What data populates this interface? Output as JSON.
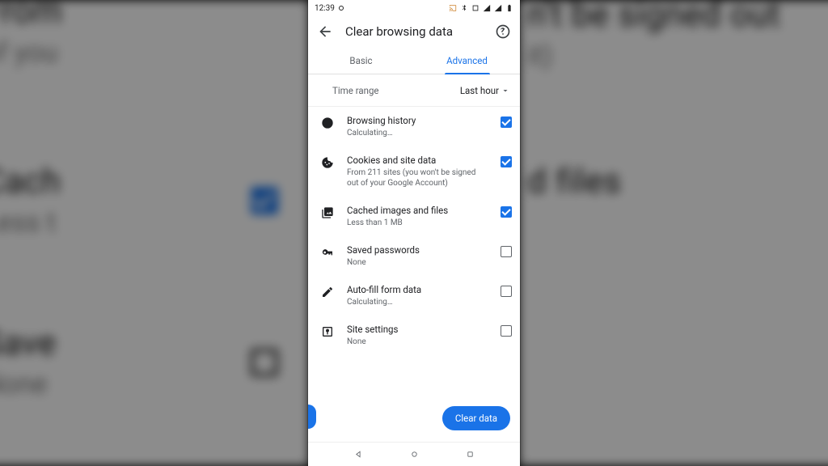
{
  "status": {
    "time": "12:39"
  },
  "header": {
    "title": "Clear browsing data"
  },
  "tabs": {
    "basic": "Basic",
    "advanced": "Advanced",
    "active": "advanced"
  },
  "timerange": {
    "label": "Time range",
    "value": "Last hour"
  },
  "rows": {
    "history": {
      "title": "Browsing history",
      "sub": "Calculating…",
      "checked": true
    },
    "cookies": {
      "title": "Cookies and site data",
      "sub": "From 211 sites (you won't be signed out of your Google Account)",
      "checked": true
    },
    "cache": {
      "title": "Cached images and files",
      "sub": "Less than 1 MB",
      "checked": true
    },
    "passwords": {
      "title": "Saved passwords",
      "sub": "None",
      "checked": false
    },
    "autofill": {
      "title": "Auto-fill form data",
      "sub": "Calculating…",
      "checked": false
    },
    "site": {
      "title": "Site settings",
      "sub": "None",
      "checked": false
    }
  },
  "footer": {
    "clear": "Clear data"
  },
  "bg": {
    "cookies_title": "From",
    "cookies_sub": "of you",
    "cache_title": "Cach",
    "cache_sub": "Less t",
    "pw_title": "Save",
    "pw_sub": "None",
    "r_cookies": "n't be signed out",
    "r_cookies2": "it)",
    "r_cache": "d files"
  }
}
